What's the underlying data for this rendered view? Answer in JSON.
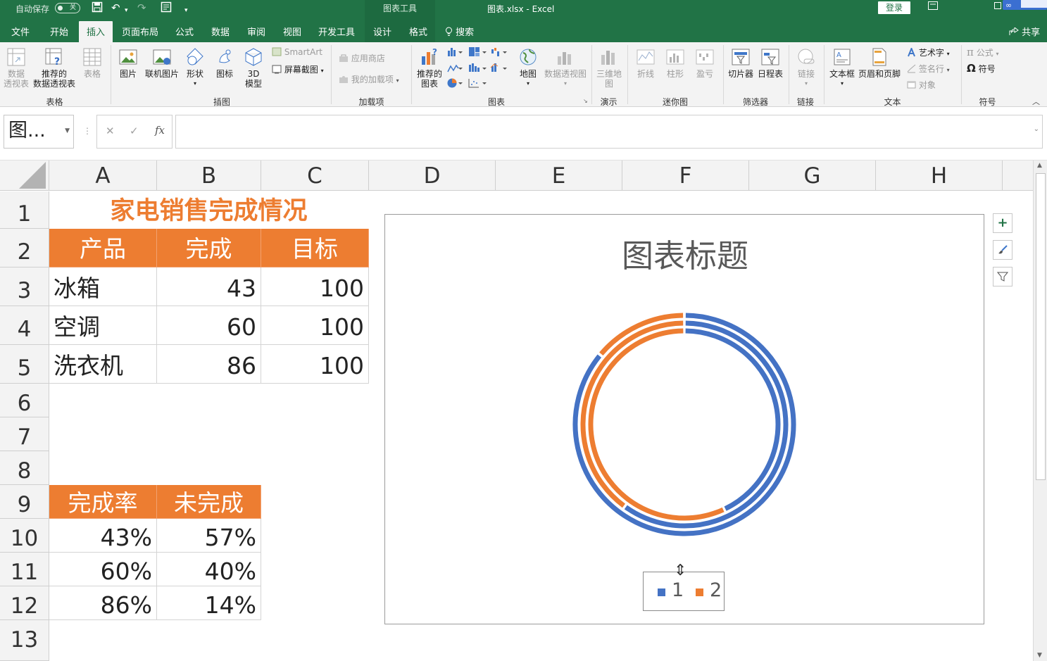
{
  "titlebar": {
    "autosave_label": "自动保存",
    "autosave_state": "关",
    "context_tab_title": "图表工具",
    "file_title": "图表.xlsx  -  Excel",
    "login_label": "登录"
  },
  "tabs": [
    "文件",
    "开始",
    "插入",
    "页面布局",
    "公式",
    "数据",
    "审阅",
    "视图",
    "开发工具",
    "设计",
    "格式"
  ],
  "active_tab": "插入",
  "search_label": "搜索",
  "share_label": "共享",
  "ribbon": {
    "groups": {
      "table": "表格",
      "illustrations": "插图",
      "addins": "加载项",
      "charts": "图表",
      "tours": "演示",
      "sparklines": "迷你图",
      "filters": "筛选器",
      "links": "链接",
      "text": "文本",
      "symbols": "符号"
    },
    "buttons": {
      "pivot_table": "数据\n透视表",
      "recommended_pivot": "推荐的\n数据透视表",
      "table": "表格",
      "pictures": "图片",
      "online_pictures": "联机图片",
      "shapes": "形状",
      "icons": "图标",
      "models_3d": "3D\n模型",
      "smartart": "SmartArt",
      "screenshot": "屏幕截图",
      "store": "应用商店",
      "my_addins": "我的加载项",
      "recommended_charts": "推荐的\n图表",
      "maps": "地图",
      "pivot_chart": "数据透视图",
      "map_3d": "三维地\n图",
      "spark_line": "折线",
      "spark_column": "柱形",
      "spark_winloss": "盈亏",
      "slicer": "切片器",
      "timeline": "日程表",
      "link": "链接",
      "textbox": "文本框",
      "header_footer": "页眉和页脚",
      "wordart": "艺术字",
      "signature": "签名行",
      "object": "对象",
      "equation": "公式",
      "symbol": "符号"
    }
  },
  "name_box": "图...",
  "columns": [
    "A",
    "B",
    "C",
    "D",
    "E",
    "F",
    "G",
    "H"
  ],
  "rows": [
    "1",
    "2",
    "3",
    "4",
    "5",
    "6",
    "7",
    "8",
    "9",
    "10",
    "11",
    "12",
    "13"
  ],
  "sheet": {
    "title": "家电销售完成情况",
    "table1_headers": [
      "产品",
      "完成",
      "目标"
    ],
    "table1_rows": [
      [
        "冰箱",
        "43",
        "100"
      ],
      [
        "空调",
        "60",
        "100"
      ],
      [
        "洗衣机",
        "86",
        "100"
      ]
    ],
    "table2_headers": [
      "完成率",
      "未完成"
    ],
    "table2_rows": [
      [
        "43%",
        "57%"
      ],
      [
        "60%",
        "40%"
      ],
      [
        "86%",
        "14%"
      ]
    ]
  },
  "chart_data": {
    "type": "doughnut",
    "title": "图表标题",
    "rings": [
      {
        "label": "43%/57%",
        "values": [
          43,
          57
        ]
      },
      {
        "label": "60%/40%",
        "values": [
          60,
          40
        ]
      },
      {
        "label": "86%/14%",
        "values": [
          86,
          14
        ]
      }
    ],
    "series": [
      {
        "name": "1",
        "color": "#4472c4"
      },
      {
        "name": "2",
        "color": "#ed7d31"
      }
    ],
    "legend_position": "bottom"
  },
  "colors": {
    "excel_green": "#217346",
    "accent_orange": "#ed7d31",
    "accent_blue": "#4472c4"
  }
}
